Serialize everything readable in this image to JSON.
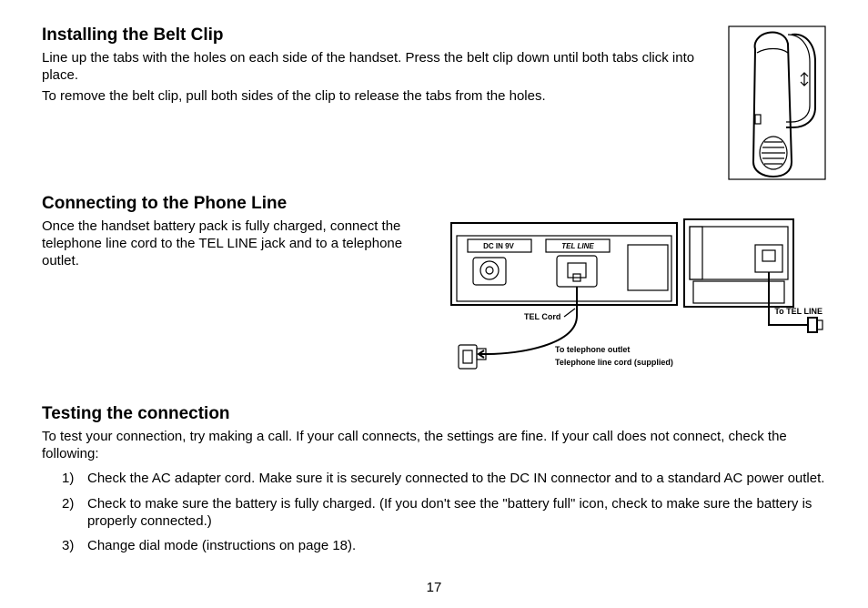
{
  "page_number": "17",
  "belt": {
    "heading": "Installing the Belt Clip",
    "p1": "Line up the tabs with the holes on each side of the handset. Press the belt clip down until both tabs click into place.",
    "p2": "To remove the belt clip, pull both sides of the clip to release the tabs from the holes."
  },
  "phone": {
    "heading": "Connecting to the Phone Line",
    "p1": "Once the handset battery pack is fully charged, connect the telephone line cord to the TEL LINE jack and to a telephone outlet.",
    "fig": {
      "dc_in": "DC IN 9V",
      "tel_line_rear": "TEL  LINE",
      "tel_cord": "TEL Cord",
      "to_outlet": "To telephone outlet",
      "supplied": "Telephone line cord  (supplied)",
      "to_tel_line": "To TEL LINE"
    }
  },
  "test": {
    "heading": "Testing the connection",
    "intro": "To test your connection, try making a call. If your call connects, the settings are fine. If your call does not connect, check the following:",
    "steps": [
      "Check the AC adapter cord. Make sure it is securely connected to the DC IN connector and to a standard AC power outlet.",
      "Check to make sure the battery is fully charged. (If you don't see the \"battery full\" icon, check to make sure the battery is properly connected.)",
      "Change dial mode (instructions on page 18)."
    ]
  }
}
